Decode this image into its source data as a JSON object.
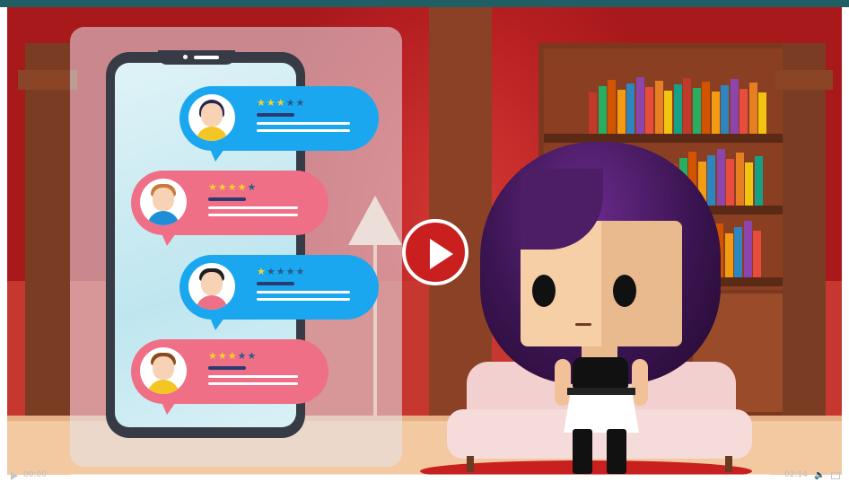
{
  "video": {
    "current_time": "00:00",
    "duration": "02:14",
    "progress": 0.0
  },
  "reviews": [
    {
      "color": "blue",
      "avatar": "woman-avatar",
      "rating": 3,
      "max_rating": 5
    },
    {
      "color": "pink",
      "avatar": "man-avatar",
      "rating": 4,
      "max_rating": 5
    },
    {
      "color": "blue",
      "avatar": "man-avatar",
      "rating": 1,
      "max_rating": 5
    },
    {
      "color": "pink",
      "avatar": "boy-avatar",
      "rating": 2.5,
      "max_rating": 5
    }
  ],
  "icons": {
    "play": "play-icon",
    "volume": "volume-icon",
    "fullscreen": "fullscreen-icon"
  },
  "colors": {
    "play_button": "#c9201f",
    "bubble_blue": "#1aa7ef",
    "bubble_pink": "#ef6f86",
    "top_bar": "#1f5f63"
  }
}
